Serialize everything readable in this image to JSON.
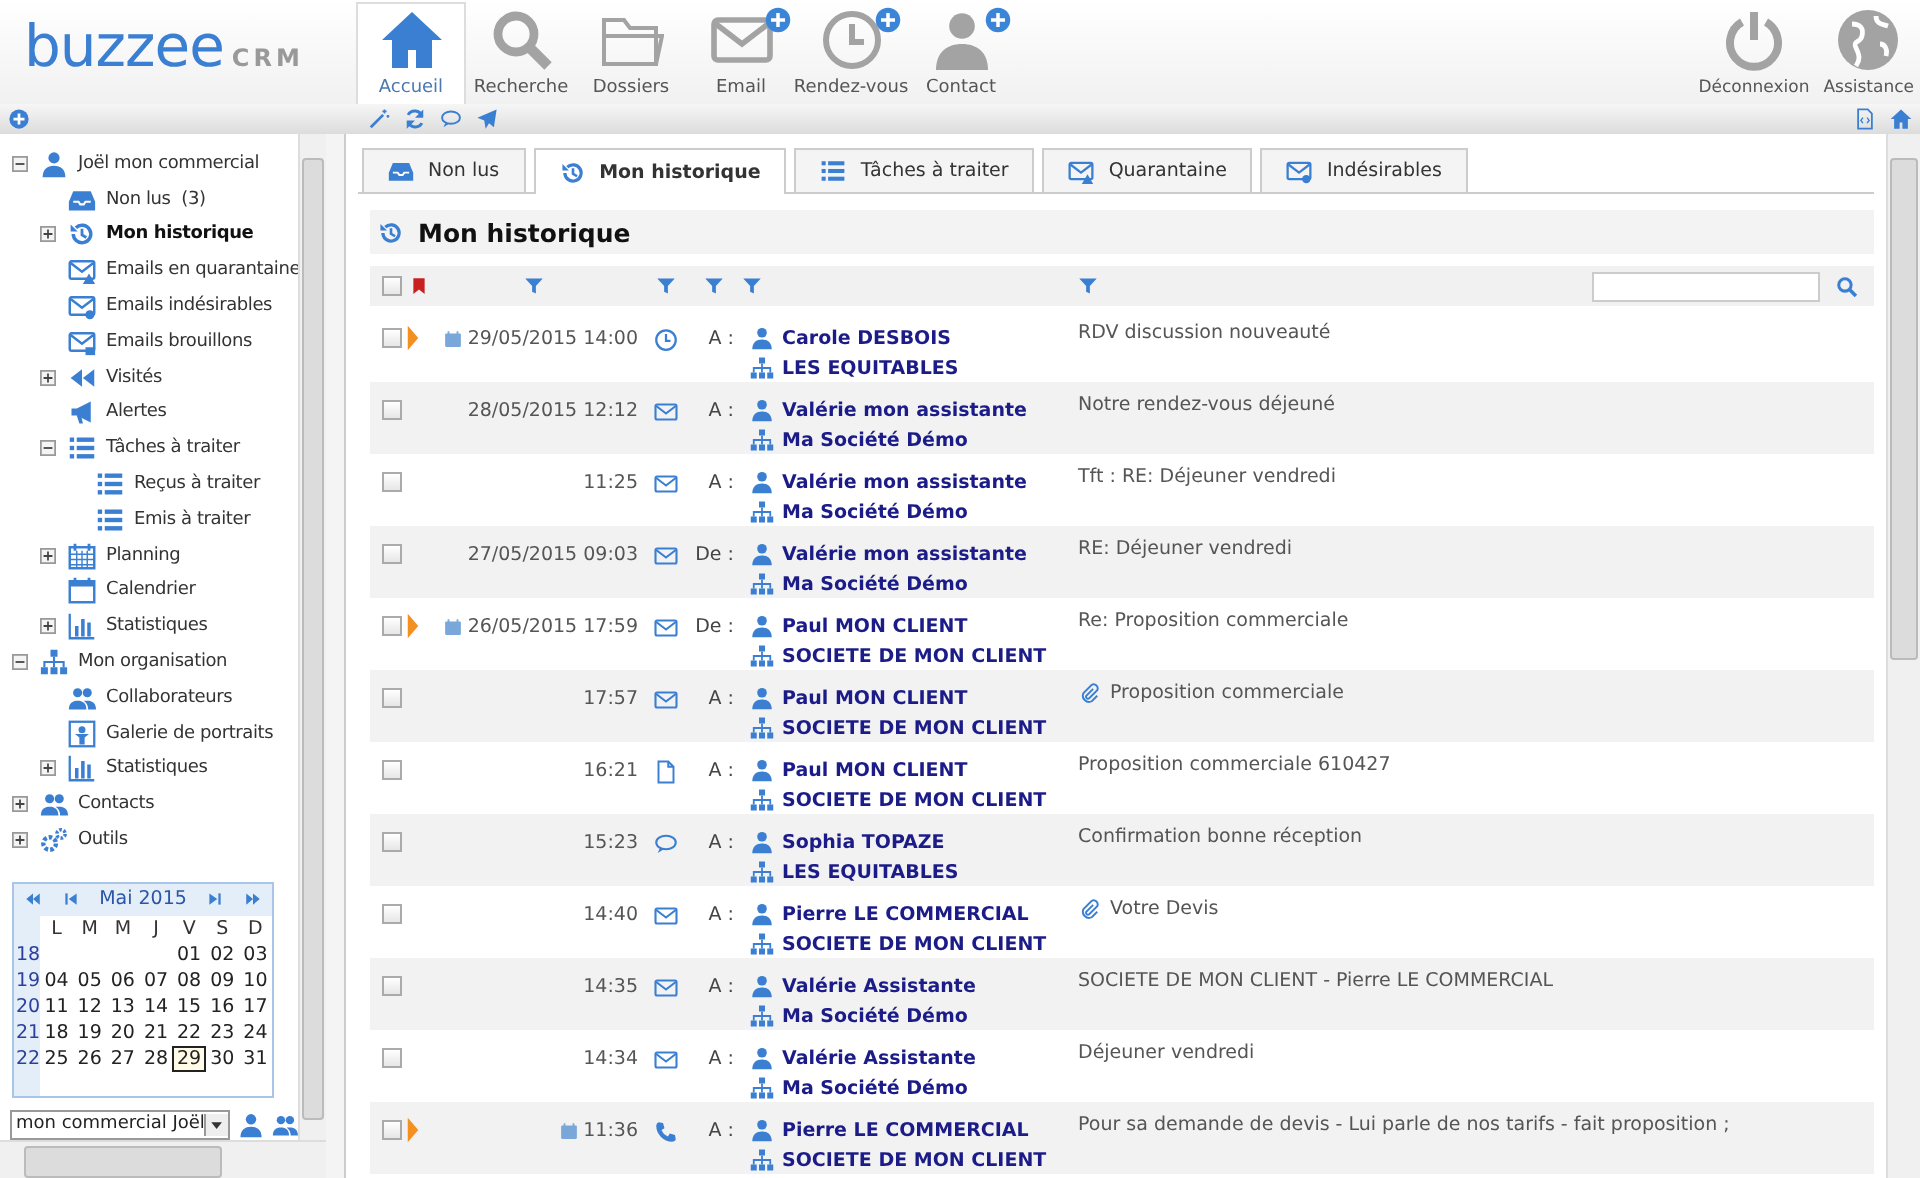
{
  "logo": {
    "name": "buzzee",
    "suffix": "CRM"
  },
  "nav": [
    {
      "label": "Accueil",
      "kind": "home",
      "selected": true,
      "add": false
    },
    {
      "label": "Recherche",
      "kind": "search",
      "selected": false,
      "add": false
    },
    {
      "label": "Dossiers",
      "kind": "folder",
      "selected": false,
      "add": false
    },
    {
      "label": "Email",
      "kind": "mail",
      "selected": false,
      "add": true
    },
    {
      "label": "Rendez-vous",
      "kind": "clock",
      "selected": false,
      "add": true
    },
    {
      "label": "Contact",
      "kind": "user",
      "selected": false,
      "add": true
    }
  ],
  "nav_right": [
    {
      "label": "Déconnexion",
      "kind": "power"
    },
    {
      "label": "Assistance",
      "kind": "globe"
    }
  ],
  "sidebar": {
    "tree": [
      {
        "label": "Joël mon commercial",
        "kind": "user",
        "selected": false,
        "expanded": true,
        "children": [
          {
            "label": "Non lus",
            "count": "(3)",
            "kind": "inbox",
            "selected": false
          },
          {
            "label": "Mon historique",
            "kind": "history",
            "selected": true,
            "expanded": false
          },
          {
            "label": "Emails en quarantaine",
            "kind": "mail-warning",
            "selected": false
          },
          {
            "label": "Emails indésirables",
            "kind": "mail-blocked",
            "selected": false
          },
          {
            "label": "Emails brouillons",
            "kind": "mail-draft",
            "selected": false
          },
          {
            "label": "Visités",
            "kind": "rewind",
            "selected": false,
            "expanded": false
          },
          {
            "label": "Alertes",
            "kind": "megaphone",
            "selected": false
          },
          {
            "label": "Tâches à traiter",
            "kind": "list",
            "selected": false,
            "expanded": true,
            "children": [
              {
                "label": "Reçus à traiter",
                "kind": "list",
                "selected": false
              },
              {
                "label": "Emis à traiter",
                "kind": "list",
                "selected": false
              }
            ]
          },
          {
            "label": "Planning",
            "kind": "calendar-grid",
            "selected": false,
            "expanded": false
          },
          {
            "label": "Calendrier",
            "kind": "calendar",
            "selected": false
          },
          {
            "label": "Statistiques",
            "kind": "chart",
            "selected": false,
            "expanded": false
          }
        ]
      },
      {
        "label": "Mon organisation",
        "kind": "org",
        "selected": false,
        "expanded": true,
        "children": [
          {
            "label": "Collaborateurs",
            "kind": "users",
            "selected": false
          },
          {
            "label": "Galerie de portraits",
            "kind": "portrait",
            "selected": false
          },
          {
            "label": "Statistiques",
            "kind": "chart",
            "selected": false,
            "expanded": false
          }
        ]
      },
      {
        "label": "Contacts",
        "kind": "users",
        "selected": false,
        "expanded": false
      },
      {
        "label": "Outils",
        "kind": "gears",
        "selected": false,
        "expanded": false
      }
    ],
    "calendar": {
      "month": "Mai 2015",
      "weekdays": [
        "L",
        "M",
        "M",
        "J",
        "V",
        "S",
        "D"
      ],
      "weeks": [
        {
          "number": "18",
          "days": [
            {
              "day": "01",
              "selected": false
            },
            {
              "day": "02",
              "selected": false
            },
            {
              "day": "03",
              "selected": false
            }
          ]
        },
        {
          "number": "19",
          "days": [
            {
              "day": "04",
              "selected": false
            },
            {
              "day": "05",
              "selected": false
            },
            {
              "day": "06",
              "selected": false
            },
            {
              "day": "07",
              "selected": false
            },
            {
              "day": "08",
              "selected": false
            },
            {
              "day": "09",
              "selected": false
            },
            {
              "day": "10",
              "selected": false
            }
          ]
        },
        {
          "number": "20",
          "days": [
            {
              "day": "11",
              "selected": false
            },
            {
              "day": "12",
              "selected": false
            },
            {
              "day": "13",
              "selected": false
            },
            {
              "day": "14",
              "selected": false
            },
            {
              "day": "15",
              "selected": false
            },
            {
              "day": "16",
              "selected": false
            },
            {
              "day": "17",
              "selected": false
            }
          ]
        },
        {
          "number": "21",
          "days": [
            {
              "day": "18",
              "selected": false
            },
            {
              "day": "19",
              "selected": false
            },
            {
              "day": "20",
              "selected": false
            },
            {
              "day": "21",
              "selected": false
            },
            {
              "day": "22",
              "selected": false
            },
            {
              "day": "23",
              "selected": false
            },
            {
              "day": "24",
              "selected": false
            }
          ]
        },
        {
          "number": "22",
          "days": [
            {
              "day": "25",
              "selected": false
            },
            {
              "day": "26",
              "selected": false
            },
            {
              "day": "27",
              "selected": false
            },
            {
              "day": "28",
              "selected": false
            },
            {
              "day": "29",
              "selected": true
            },
            {
              "day": "30",
              "selected": false
            },
            {
              "day": "31",
              "selected": false
            }
          ]
        }
      ]
    },
    "user_select": {
      "value": "mon commercial Joël"
    }
  },
  "tabs": [
    {
      "label": "Non lus",
      "kind": "inbox",
      "selected": false
    },
    {
      "label": "Mon historique",
      "kind": "history",
      "selected": true
    },
    {
      "label": "Tâches à traiter",
      "kind": "list",
      "selected": false
    },
    {
      "label": "Quarantaine",
      "kind": "mail-warning",
      "selected": false
    },
    {
      "label": "Indésirables",
      "kind": "mail-blocked",
      "selected": false
    }
  ],
  "section_title": "Mon historique",
  "select_all": {
    "checked": false
  },
  "rows": [
    {
      "checked": false,
      "flagged": true,
      "scheduled": true,
      "date": "29/05/2015 14:00",
      "kind": "meeting",
      "direction": "A :",
      "contact": "Carole DESBOIS",
      "company": "LES EQUITABLES",
      "attachment": false,
      "subject": "RDV discussion nouveauté"
    },
    {
      "checked": false,
      "flagged": false,
      "scheduled": false,
      "date": "28/05/2015 12:12",
      "kind": "email",
      "direction": "A :",
      "contact": "Valérie mon assistante",
      "company": "Ma Société Démo",
      "attachment": false,
      "subject": "Notre rendez-vous déjeuné"
    },
    {
      "checked": false,
      "flagged": false,
      "scheduled": false,
      "date": "11:25",
      "kind": "email",
      "direction": "A :",
      "contact": "Valérie mon assistante",
      "company": "Ma Société Démo",
      "attachment": false,
      "subject": "Tft : RE: Déjeuner vendredi"
    },
    {
      "checked": false,
      "flagged": false,
      "scheduled": false,
      "date": "27/05/2015 09:03",
      "kind": "email",
      "direction": "De :",
      "contact": "Valérie mon assistante",
      "company": "Ma Société Démo",
      "attachment": false,
      "subject": "RE: Déjeuner vendredi"
    },
    {
      "checked": false,
      "flagged": true,
      "scheduled": true,
      "date": "26/05/2015 17:59",
      "kind": "email",
      "direction": "De :",
      "contact": "Paul MON CLIENT",
      "company": "SOCIETE DE MON CLIENT",
      "attachment": false,
      "subject": "Re: Proposition commerciale"
    },
    {
      "checked": false,
      "flagged": false,
      "scheduled": false,
      "date": "17:57",
      "kind": "email",
      "direction": "A :",
      "contact": "Paul MON CLIENT",
      "company": "SOCIETE DE MON CLIENT",
      "attachment": true,
      "subject": "Proposition commerciale"
    },
    {
      "checked": false,
      "flagged": false,
      "scheduled": false,
      "date": "16:21",
      "kind": "document",
      "direction": "A :",
      "contact": "Paul MON CLIENT",
      "company": "SOCIETE DE MON CLIENT",
      "attachment": false,
      "subject": "Proposition commerciale 610427"
    },
    {
      "checked": false,
      "flagged": false,
      "scheduled": false,
      "date": "15:23",
      "kind": "chat",
      "direction": "A :",
      "contact": "Sophia TOPAZE",
      "company": "LES EQUITABLES",
      "attachment": false,
      "subject": "Confirmation bonne réception"
    },
    {
      "checked": false,
      "flagged": false,
      "scheduled": false,
      "date": "14:40",
      "kind": "email",
      "direction": "A :",
      "contact": "Pierre LE COMMERCIAL",
      "company": "SOCIETE DE MON CLIENT",
      "attachment": true,
      "subject": "Votre Devis"
    },
    {
      "checked": false,
      "flagged": false,
      "scheduled": false,
      "date": "14:35",
      "kind": "email",
      "direction": "A :",
      "contact": "Valérie Assistante",
      "company": "Ma Société Démo",
      "attachment": false,
      "subject": "SOCIETE DE MON CLIENT - Pierre LE COMMERCIAL"
    },
    {
      "checked": false,
      "flagged": false,
      "scheduled": false,
      "date": "14:34",
      "kind": "email",
      "direction": "A :",
      "contact": "Valérie Assistante",
      "company": "Ma Société Démo",
      "attachment": false,
      "subject": "Déjeuner vendredi"
    },
    {
      "checked": false,
      "flagged": true,
      "scheduled": true,
      "date": "11:36",
      "kind": "call",
      "direction": "A :",
      "contact": "Pierre LE COMMERCIAL",
      "company": "SOCIETE DE MON CLIENT",
      "attachment": false,
      "subject": "Pour sa demande de devis - Lui parle de nos tarifs - fait proposition ;"
    }
  ]
}
